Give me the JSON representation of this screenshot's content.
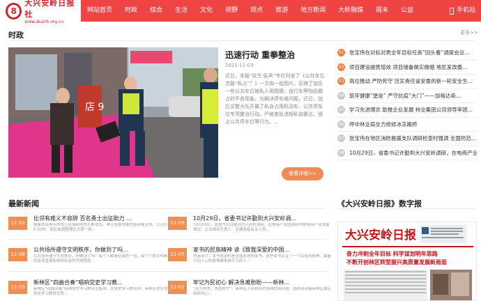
{
  "header": {
    "logo_title": "大兴安岭日报社",
    "logo_url": "www.dxalrb.org.cn",
    "nav": [
      "网站首页",
      "时政",
      "综合",
      "生活",
      "文化",
      "视野",
      "观点",
      "旅游",
      "地方新闻",
      "大岭融媒",
      "周末",
      "公益"
    ],
    "mobile": "手机站"
  },
  "politics": {
    "heading": "时政",
    "more": "更多>>",
    "feature": {
      "title": "迅速行动 重拳整治",
      "date": "2021-11-03",
      "desc": "近日，本报“民生·民声”专栏刊发了《公共车位岂能“私占”？》一文和一组图片，反映了加区一些公共车位被私人用圆牌、自行车等物品霸占的不良现象。为解决停车难问题，近日，加区交警大队开展了私自占用机动车、公共停车位专项整治行动。严格查处违规私自霸占，侵占公共停车位等行为。...",
      "detail_btn": "查看详细>>",
      "shop_sign": "店 9"
    },
    "list": [
      {
        "num": "01",
        "text": "张宝伟在对标对表全年目标任务“回头看”调度会议..."
      },
      {
        "num": "02",
        "text": "项目建设提质增效 项目储备做实做细 地区发改委..."
      },
      {
        "num": "03",
        "text": "高位推动 严防死守 压实责任省安委的新一轮安全生..."
      },
      {
        "num": "04",
        "text": "筑牢健康“堡垒” 严守抗疫“大门”——加格达奇..."
      },
      {
        "num": "05",
        "text": "学习先进理念 助推企业发展 林业集团公司领导率团..."
      },
      {
        "num": "06",
        "text": "呼中林业局全力抢修冰冻路桥"
      },
      {
        "num": "07",
        "text": "张宝伟在地区消防救援支队调研检查时强调 全面防范..."
      },
      {
        "num": "08",
        "text": "10月29日，省委书记许勤到大兴安岭调研，在电商产业..."
      }
    ]
  },
  "latest": {
    "heading": "最新新闻",
    "items": [
      {
        "date": "11-10",
        "title": "比邻有难义不容辞 百名勇士出征助力 ...",
        "sub": "随着本轮黑河市本土疫情病例的不断增加，黑河省委市委积极部署安排，11月1日6:30时，加区抽调整理区大荔一批..."
      },
      {
        "date": "11-09",
        "title": "10月29日，省委书记许勤到大兴安岭调...",
        "sub": "10月29日，省委书记许勤到大兴安岭调研，在电商产业园调研考察电商产业发展情况，企业相关负责人、区属各级有关人员..."
      },
      {
        "date": "11-08",
        "title": "公共场所遵守文明秩序，你做到了吗...",
        "sub": "公共场所遵守文明秩序，你做到了吗？每个人都是社会的一员，每个个体文明素质的高低直接影响到社会的文明程度..."
      },
      {
        "date": "11-05",
        "title": "家书的民族精神 读《致我深爱的中国...",
        "sub": "内容简介：本书收录的是全国各地的家书，这些家书见证了一个民族的精神。最能打动人心的故事都来自平凡的人..."
      },
      {
        "date": "11-03",
        "title": "新林区“四曲合奏”唱响党史学习教...",
        "sub": "新林区“四曲合奏”唱响党史学习教育主旋律。在党史学习教育中，新林区充分发挥党史学习教育优势..."
      },
      {
        "date": "11-02",
        "title": "牢记为民初心 解决急难愁盼——新林...",
        "sub": "“民为邦本，本固邦宁”。新林区人民群众的急难愁盼问题，始终牵动着新林区委区政府的心..."
      }
    ]
  },
  "digital": {
    "heading": "《大兴安岭日报》数字报",
    "masthead": "大兴安岭日报",
    "headline": "奋力冲刺全年目标 科学谋划明年思路",
    "subline": "不断开创林区转型振兴高质量发展新局面"
  }
}
